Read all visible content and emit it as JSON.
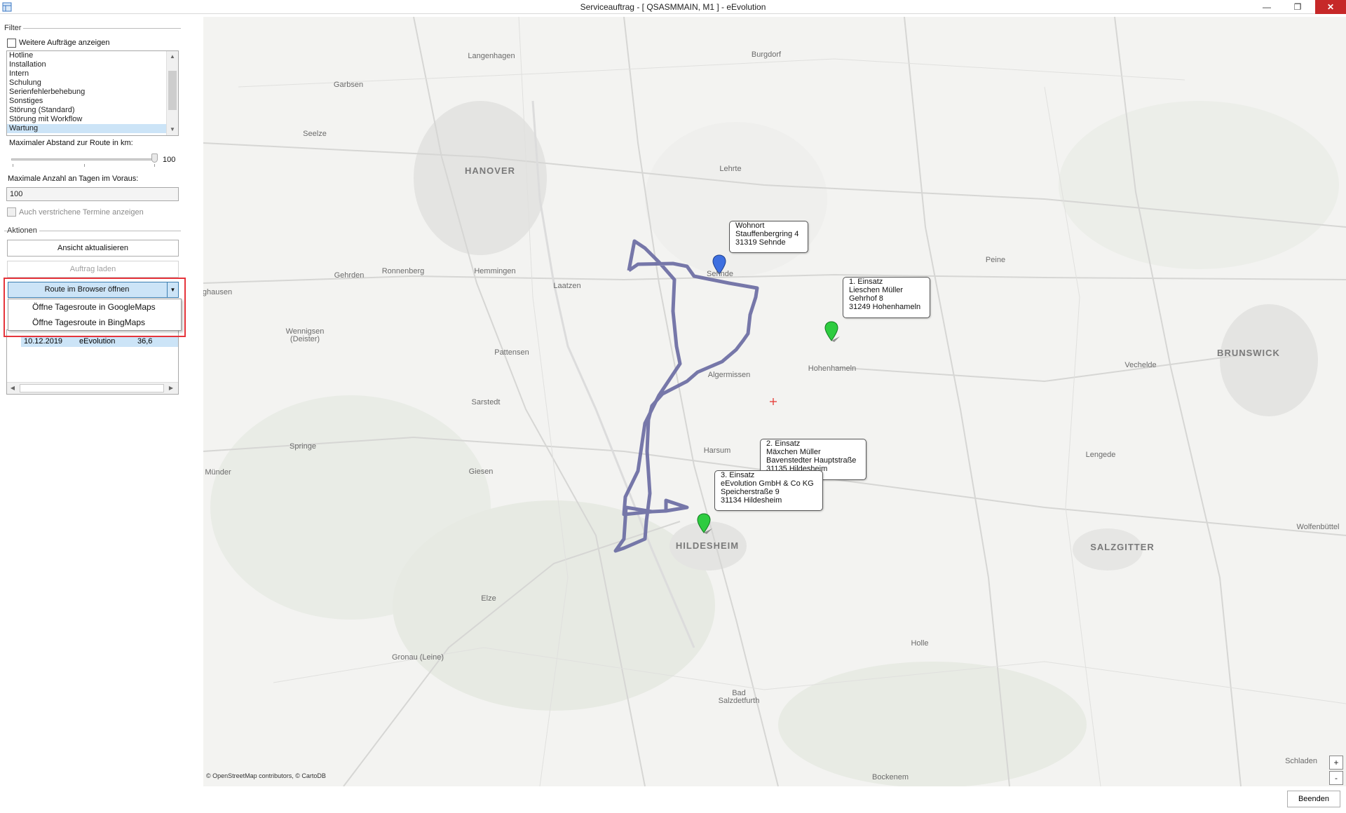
{
  "window": {
    "title": "Serviceauftrag - [ QSASMMAIN, M1 ]  -  eEvolution",
    "minimize_glyph": "—",
    "maximize_glyph": "❐",
    "close_glyph": "✕"
  },
  "filter": {
    "group_label": "Filter",
    "show_more_label": "Weitere Aufträge anzeigen",
    "types": [
      "Hotline",
      "Installation",
      "Intern",
      "Schulung",
      "Serienfehlerbehebung",
      "Sonstiges",
      "Störung (Standard)",
      "Störung mit Workflow",
      "Wartung"
    ],
    "selected_type": "Wartung",
    "max_distance_label": "Maximaler Abstand zur Route in km:",
    "max_distance_value": "100",
    "max_days_label": "Maximale Anzahl an Tagen im Voraus:",
    "max_days_value": "100",
    "past_appointments_label": "Auch verstrichene Termine anzeigen"
  },
  "actions": {
    "group_label": "Aktionen",
    "refresh_label": "Ansicht aktualisieren",
    "load_order_label": "Auftrag laden",
    "open_route_label": "Route im Browser öffnen",
    "menu_items": [
      "Öffne Tagesroute in GoogleMaps",
      "Öffne Tagesroute in BingMaps"
    ]
  },
  "route_table": {
    "rows": [
      {
        "date": "10.12.2019",
        "name": "eEvolution",
        "distance": "36,6"
      }
    ]
  },
  "map": {
    "places": [
      {
        "name": "Langenhagen",
        "type": "town"
      },
      {
        "name": "Burgdorf",
        "type": "town"
      },
      {
        "name": "Garbsen",
        "type": "town"
      },
      {
        "name": "Seelze",
        "type": "town"
      },
      {
        "name": "HANOVER",
        "type": "city"
      },
      {
        "name": "Lehrte",
        "type": "town"
      },
      {
        "name": "Gehrden",
        "type": "town"
      },
      {
        "name": "Ronnenberg",
        "type": "town"
      },
      {
        "name": "Hemmingen",
        "type": "town"
      },
      {
        "name": "Laatzen",
        "type": "town"
      },
      {
        "name": "Sehnde",
        "type": "town"
      },
      {
        "name": "Peine",
        "type": "town"
      },
      {
        "name": "ghausen",
        "type": "town"
      },
      {
        "name": "Wennigsen\n(Deister)",
        "type": "town"
      },
      {
        "name": "Pattensen",
        "type": "town"
      },
      {
        "name": "Algermissen",
        "type": "town"
      },
      {
        "name": "Hohenhameln",
        "type": "town"
      },
      {
        "name": "BRUNSWICK",
        "type": "city"
      },
      {
        "name": "Vechelde",
        "type": "town"
      },
      {
        "name": "Sarstedt",
        "type": "town"
      },
      {
        "name": "Springe",
        "type": "town"
      },
      {
        "name": "Harsum",
        "type": "town"
      },
      {
        "name": "Lengede",
        "type": "town"
      },
      {
        "name": "Münder",
        "type": "town"
      },
      {
        "name": "Giesen",
        "type": "town"
      },
      {
        "name": "HILDESHEIM",
        "type": "city"
      },
      {
        "name": "SALZGITTER",
        "type": "city"
      },
      {
        "name": "Wolfenbüttel",
        "type": "town"
      },
      {
        "name": "Elze",
        "type": "town"
      },
      {
        "name": "Holle",
        "type": "town"
      },
      {
        "name": "Gronau (Leine)",
        "type": "town"
      },
      {
        "name": "Bad\nSalzdetfurth",
        "type": "town"
      },
      {
        "name": "Bockenem",
        "type": "town"
      },
      {
        "name": "Schladen",
        "type": "town"
      }
    ],
    "callouts": [
      {
        "id": "home",
        "lines": [
          "Wohnort",
          "Stauffenbergring 4",
          "31319 Sehnde"
        ]
      },
      {
        "id": "stop1",
        "lines": [
          "1. Einsatz",
          "Lieschen Müller",
          "Gehrhof 8",
          "31249 Hohenhameln"
        ]
      },
      {
        "id": "stop2",
        "lines": [
          "2. Einsatz",
          "Mäxchen Müller",
          "Bavenstedter Hauptstraße",
          "31135 Hildesheim"
        ]
      },
      {
        "id": "stop3",
        "lines": [
          "3. Einsatz",
          "eEvolution GmbH & Co KG",
          "Speicherstraße 9",
          "31134 Hildesheim"
        ]
      }
    ],
    "attribution": "© OpenStreetMap contributors, © CartoDB",
    "zoom_in": "+",
    "zoom_out": "-",
    "colors": {
      "route": "#6b6ca3",
      "home_marker": "#3d6fe0",
      "stop_marker": "#2ecc40",
      "crosshair": "#e53935"
    }
  },
  "footer": {
    "finish_label": "Beenden"
  }
}
